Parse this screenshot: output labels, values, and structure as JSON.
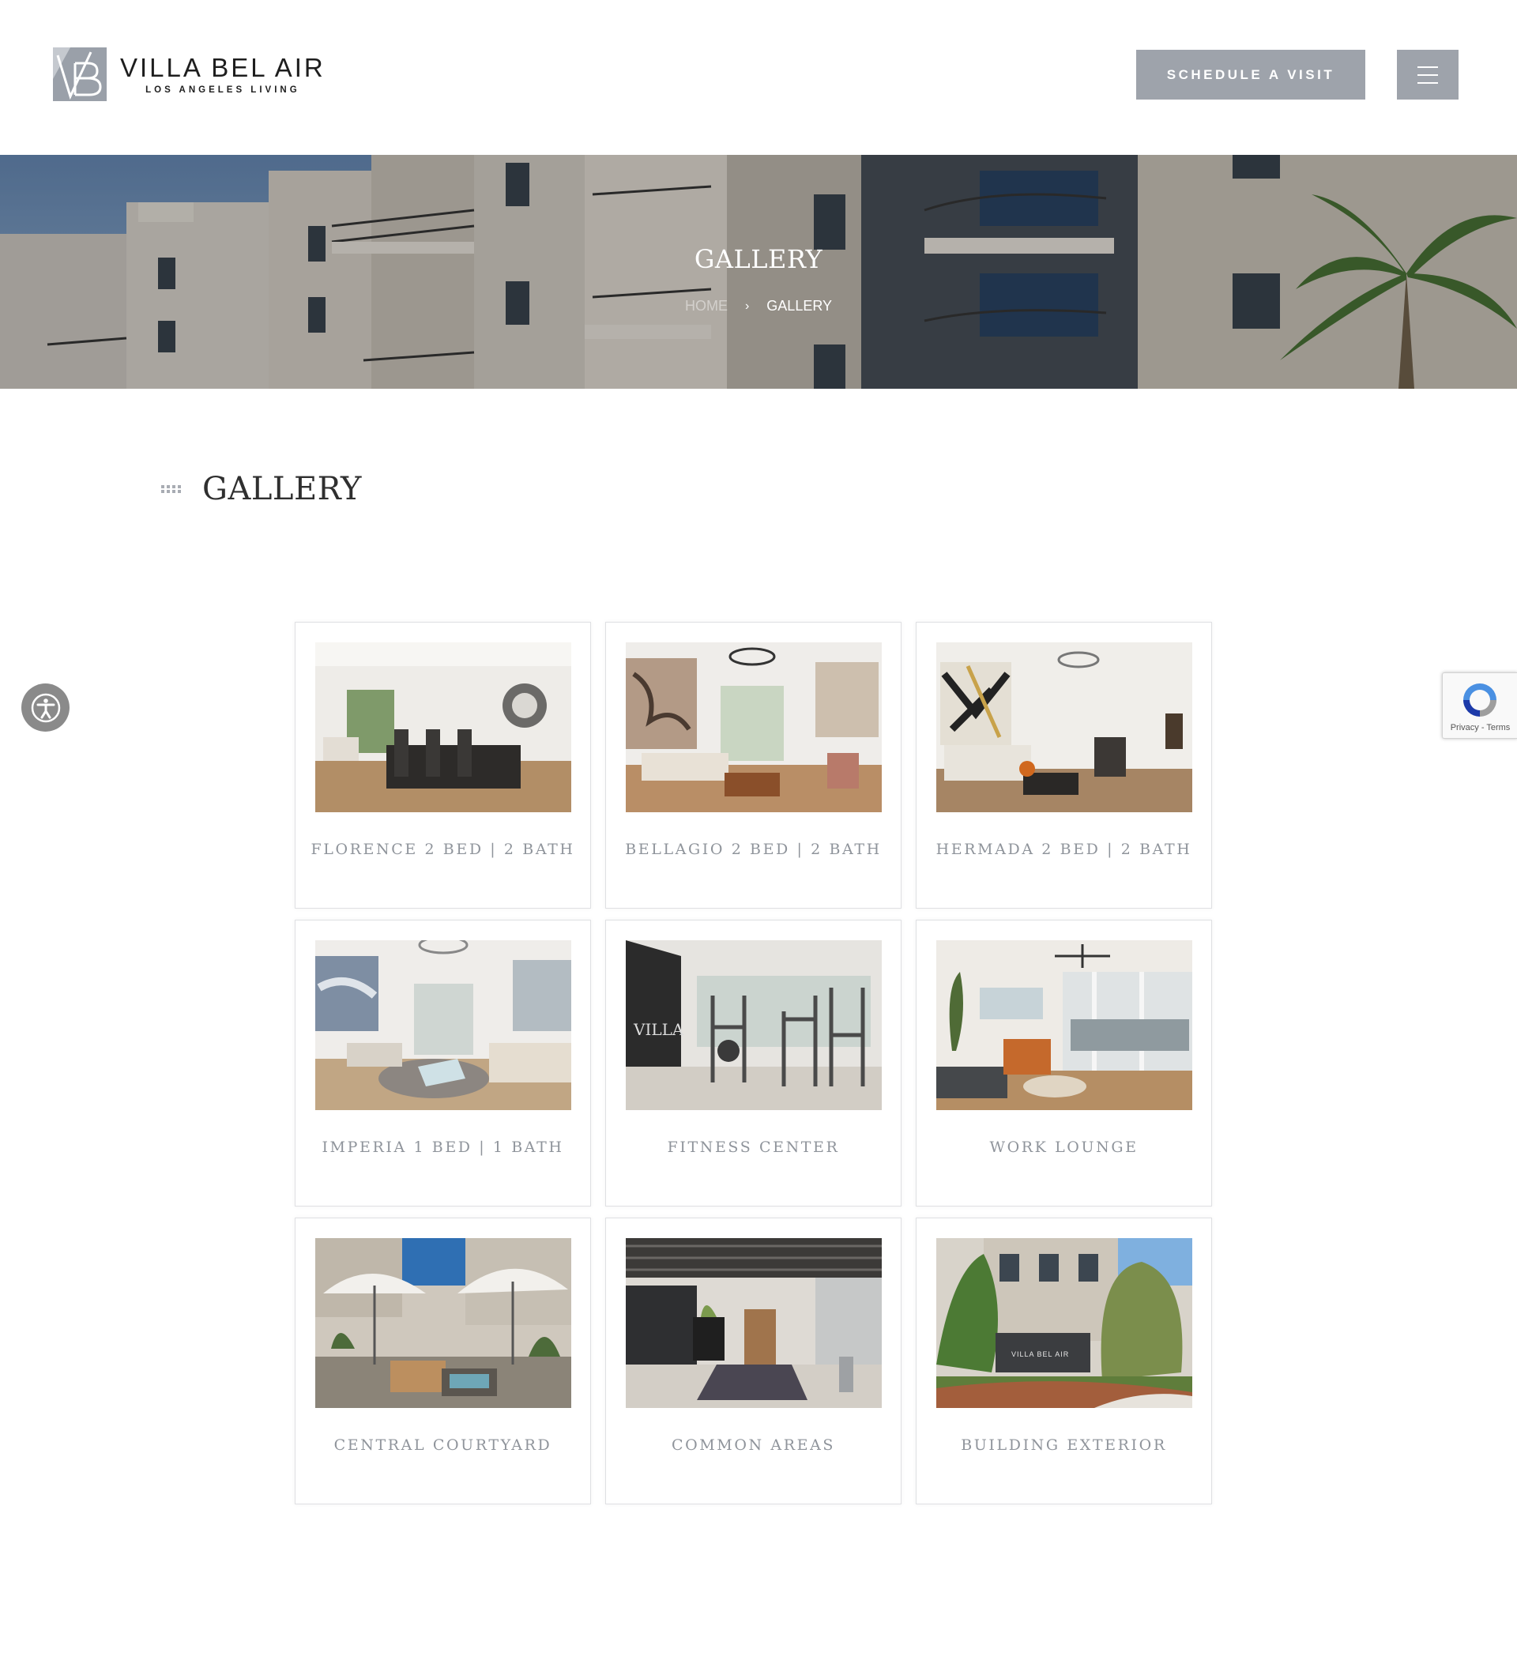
{
  "header": {
    "logo_title": "VILLA BEL AIR",
    "logo_subtitle": "LOS ANGELES LIVING",
    "schedule_label": "SCHEDULE A VISIT",
    "menu_icon": "hamburger-icon"
  },
  "hero": {
    "title": "GALLERY",
    "breadcrumb_home": "HOME",
    "breadcrumb_separator": "›",
    "breadcrumb_current": "GALLERY"
  },
  "section": {
    "title": "GALLERY",
    "icon": "dots-grid-icon"
  },
  "gallery": [
    {
      "label": "FLORENCE 2 BED | 2 BATH"
    },
    {
      "label": "BELLAGIO 2 BED | 2 BATH"
    },
    {
      "label": "HERMADA 2 BED | 2 BATH"
    },
    {
      "label": "IMPERIA 1 BED | 1 BATH"
    },
    {
      "label": "FITNESS CENTER"
    },
    {
      "label": "WORK LOUNGE"
    },
    {
      "label": "CENTRAL COURTYARD"
    },
    {
      "label": "COMMON AREAS"
    },
    {
      "label": "BUILDING EXTERIOR"
    }
  ],
  "widgets": {
    "accessibility_icon": "accessibility-icon",
    "recaptcha_links": "Privacy - Terms"
  },
  "colors": {
    "accent_gray": "#9ea3ab",
    "label_gray": "#8f949b",
    "card_border": "#dfe0e3"
  }
}
